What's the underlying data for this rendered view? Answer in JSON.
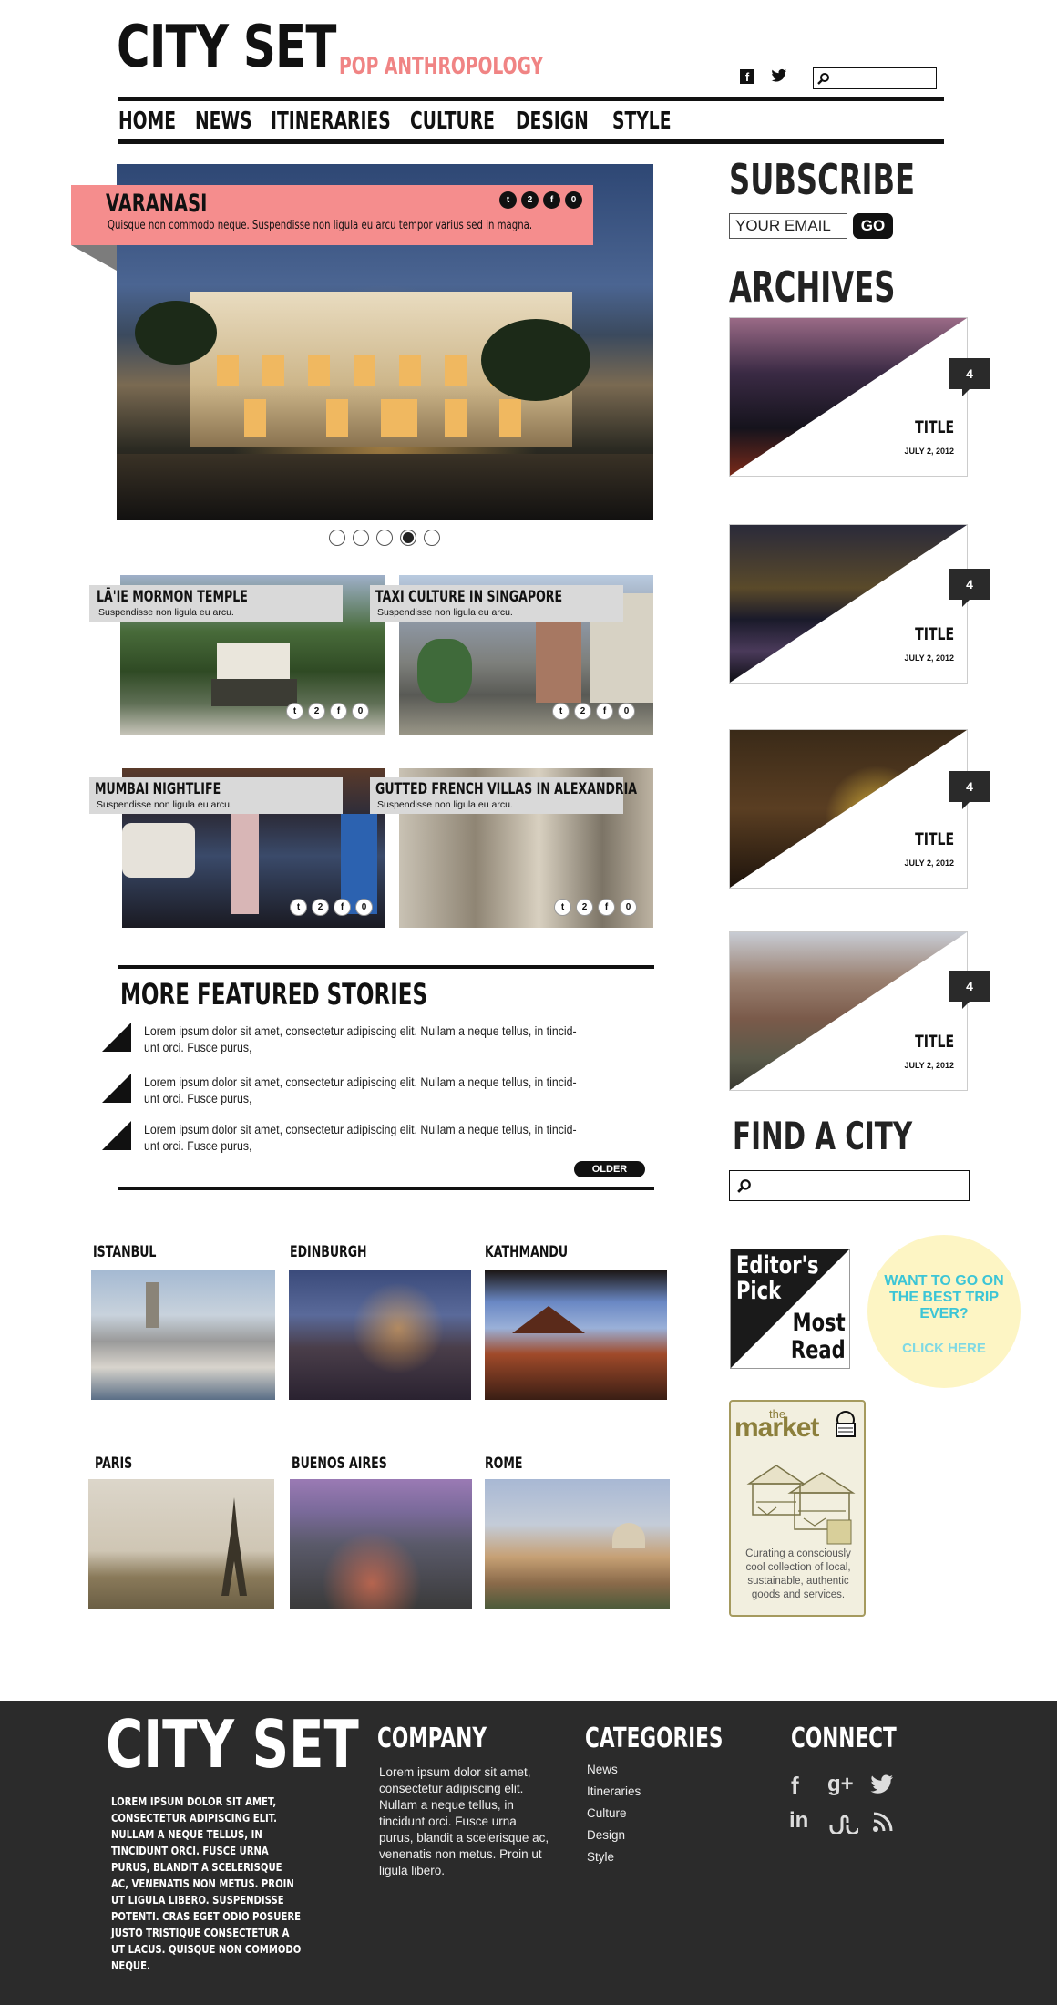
{
  "header": {
    "logo": "CITY SET",
    "tagline": "POP ANTHROPOLOGY",
    "icons": [
      "facebook-icon",
      "twitter-icon",
      "search-icon"
    ]
  },
  "nav": [
    "HOME",
    "NEWS",
    "ITINERARIES",
    "CULTURE",
    "DESIGN",
    "STYLE"
  ],
  "hero": {
    "title": "VARANASI",
    "subtitle": "Quisque non commodo neque. Suspendisse non ligula eu arcu tempor varius sed in magna.",
    "share_count": "2",
    "like_count": "0",
    "slides": 5,
    "active_slide": 4
  },
  "stories": [
    {
      "title": "LĀ'IE MORMON TEMPLE",
      "subtitle": "Suspendisse non ligula eu arcu.",
      "share_count": "2",
      "like_count": "0"
    },
    {
      "title": "TAXI CULTURE IN SINGAPORE",
      "subtitle": "Suspendisse non ligula eu arcu.",
      "share_count": "2",
      "like_count": "0"
    },
    {
      "title": "MUMBAI NIGHTLIFE",
      "subtitle": "Suspendisse non ligula eu arcu.",
      "share_count": "2",
      "like_count": "0"
    },
    {
      "title": "GUTTED FRENCH VILLAS IN ALEXANDRIA",
      "subtitle": "Suspendisse non ligula eu arcu.",
      "share_count": "2",
      "like_count": "0"
    }
  ],
  "more_featured": {
    "title": "MORE FEATURED STORIES",
    "items": [
      "Lorem ipsum dolor sit amet, consectetur adipiscing elit. Nullam a neque tellus, in tincid-unt orci. Fusce purus,",
      "Lorem ipsum dolor sit amet, consectetur adipiscing elit. Nullam a neque tellus, in tincid-unt orci. Fusce purus,",
      "Lorem ipsum dolor sit amet, consectetur adipiscing elit. Nullam a neque tellus, in tincid-unt orci. Fusce purus,"
    ],
    "older_label": "OLDER"
  },
  "sidebar": {
    "subscribe_title": "SUBSCRIBE",
    "email_placeholder": "YOUR EMAIL",
    "go_label": "GO",
    "archives_title": "ARCHIVES",
    "archives": [
      {
        "title": "TITLE",
        "date": "JULY 2, 2012",
        "count": "4"
      },
      {
        "title": "TITLE",
        "date": "JULY 2, 2012",
        "count": "4"
      },
      {
        "title": "TITLE",
        "date": "JULY 2, 2012",
        "count": "4"
      },
      {
        "title": "TITLE",
        "date": "JULY 2, 2012",
        "count": "4"
      }
    ],
    "find_city_title": "FIND A CITY",
    "editors_pick": {
      "line1": "Editor's",
      "line2": "Pick",
      "line3": "Most",
      "line4": "Read"
    },
    "want_to_go": {
      "text": "WANT TO GO ON THE BEST TRIP EVER?",
      "link": "CLICK HERE"
    },
    "market": {
      "the": "the",
      "name": "market",
      "text": "Curating a consciously cool collection of local, sustainable, authentic goods and services."
    }
  },
  "cities": [
    "ISTANBUL",
    "EDINBURGH",
    "KATHMANDU",
    "PARIS",
    "BUENOS AIRES",
    "ROME"
  ],
  "footer": {
    "logo": "CITY SET",
    "about": "LOREM IPSUM DOLOR SIT AMET, CONSECTETUR ADIPISCING ELIT. NULLAM A NEQUE TELLUS, IN TINCIDUNT ORCI. FUSCE URNA PURUS, BLANDIT A SCELERISQUE AC, VENENATIS NON METUS. PROIN UT LIGULA LIBERO. SUSPENDISSE POTENTI. CRAS EGET ODIO POSUERE JUSTO TRISTIQUE CONSECTETUR A UT LACUS. QUISQUE NON COMMODO NEQUE.",
    "company_title": "COMPANY",
    "company_text": "Lorem ipsum dolor sit amet, consectetur adipiscing elit. Nullam a neque tellus, in tincidunt orci. Fusce urna purus, blandit a scelerisque ac, venenatis non metus. Proin ut ligula libero.",
    "categories_title": "CATEGORIES",
    "categories": [
      "News",
      "Itineraries",
      "Culture",
      "Design",
      "Style"
    ],
    "connect_title": "CONNECT",
    "connect_icons": [
      "facebook-icon",
      "google-plus-icon",
      "twitter-icon",
      "linkedin-icon",
      "stumbleupon-icon",
      "rss-icon"
    ]
  },
  "colors": {
    "accent_pink": "#f58d8d",
    "footer_bg": "#2b2b2b",
    "promo_yellow": "#fdf5c4",
    "promo_teal": "#3cc5d6",
    "market_olive": "#8c7f3c"
  }
}
